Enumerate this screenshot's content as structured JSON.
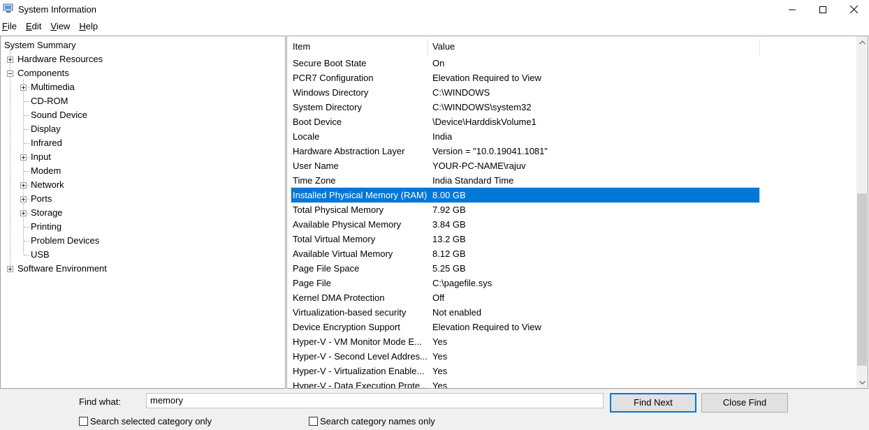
{
  "window": {
    "title": "System Information"
  },
  "menu": [
    {
      "label": "File",
      "key": "F",
      "rest": "ile"
    },
    {
      "label": "Edit",
      "key": "E",
      "rest": "dit"
    },
    {
      "label": "View",
      "key": "V",
      "rest": "iew"
    },
    {
      "label": "Help",
      "key": "H",
      "rest": "elp"
    }
  ],
  "tree": {
    "root": "System Summary",
    "hardware": "Hardware Resources",
    "components": "Components",
    "children": [
      "Multimedia",
      "CD-ROM",
      "Sound Device",
      "Display",
      "Infrared",
      "Input",
      "Modem",
      "Network",
      "Ports",
      "Storage",
      "Printing",
      "Problem Devices",
      "USB"
    ],
    "expandable_children": [
      "Multimedia",
      "Input",
      "Network",
      "Ports",
      "Storage"
    ],
    "software": "Software Environment"
  },
  "list": {
    "headers": {
      "item": "Item",
      "value": "Value"
    },
    "rows": [
      {
        "item": "Secure Boot State",
        "value": "On"
      },
      {
        "item": "PCR7 Configuration",
        "value": "Elevation Required to View"
      },
      {
        "item": "Windows Directory",
        "value": "C:\\WINDOWS"
      },
      {
        "item": "System Directory",
        "value": "C:\\WINDOWS\\system32"
      },
      {
        "item": "Boot Device",
        "value": "\\Device\\HarddiskVolume1"
      },
      {
        "item": "Locale",
        "value": "India"
      },
      {
        "item": "Hardware Abstraction Layer",
        "value": "Version = \"10.0.19041.1081\""
      },
      {
        "item": "User Name",
        "value": "YOUR-PC-NAME\\rajuv"
      },
      {
        "item": "Time Zone",
        "value": "India Standard Time"
      },
      {
        "item": "Installed Physical Memory (RAM)",
        "value": "8.00 GB",
        "selected": true
      },
      {
        "item": "Total Physical Memory",
        "value": "7.92 GB"
      },
      {
        "item": "Available Physical Memory",
        "value": "3.84 GB"
      },
      {
        "item": "Total Virtual Memory",
        "value": "13.2 GB"
      },
      {
        "item": "Available Virtual Memory",
        "value": "8.12 GB"
      },
      {
        "item": "Page File Space",
        "value": "5.25 GB"
      },
      {
        "item": "Page File",
        "value": "C:\\pagefile.sys"
      },
      {
        "item": "Kernel DMA Protection",
        "value": "Off"
      },
      {
        "item": "Virtualization-based security",
        "value": "Not enabled"
      },
      {
        "item": "Device Encryption Support",
        "value": "Elevation Required to View"
      },
      {
        "item": "Hyper-V - VM Monitor Mode E...",
        "value": "Yes"
      },
      {
        "item": "Hyper-V - Second Level Addres...",
        "value": "Yes"
      },
      {
        "item": "Hyper-V - Virtualization Enable...",
        "value": "Yes"
      },
      {
        "item": "Hyper-V - Data Execution Prote...",
        "value": "Yes"
      }
    ]
  },
  "find": {
    "label": "Find what:",
    "value": "memory",
    "find_next": "Find Next",
    "close_find": "Close Find",
    "search_selected": "Search selected category only",
    "search_names": "Search category names only"
  },
  "colors": {
    "selection": "#0078d7",
    "panel_bg": "#f0f0f0"
  }
}
